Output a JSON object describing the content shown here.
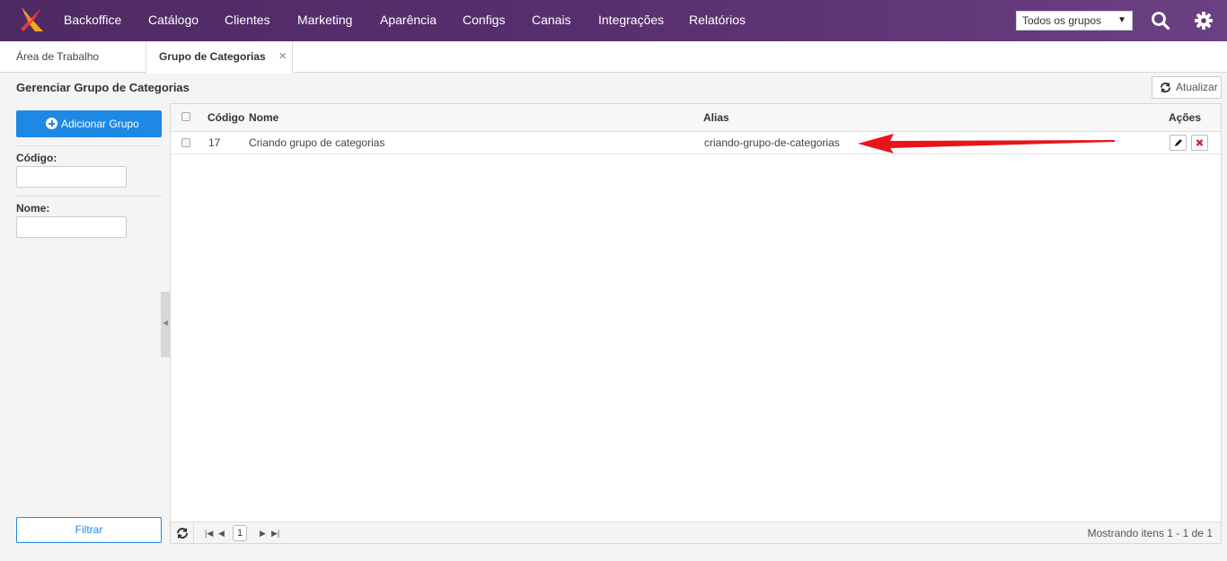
{
  "nav": {
    "items": [
      "Backoffice",
      "Catálogo",
      "Clientes",
      "Marketing",
      "Aparência",
      "Configs",
      "Canais",
      "Integrações",
      "Relatórios"
    ],
    "group_select": "Todos os grupos",
    "logo_icon": "x-logo-icon",
    "search_icon": "search-icon",
    "settings_icon": "gear-icon"
  },
  "tabs": [
    {
      "label": "Área de Trabalho",
      "active": false
    },
    {
      "label": "Grupo de Categorias",
      "active": true,
      "close": "×"
    }
  ],
  "page": {
    "title": "Gerenciar Grupo de Categorias",
    "refresh_label": "Atualizar"
  },
  "filters": {
    "add_label": "Adicionar Grupo",
    "code_label": "Código:",
    "code_value": "",
    "name_label": "Nome:",
    "name_value": "",
    "filter_label": "Filtrar"
  },
  "grid": {
    "columns": [
      "Código",
      "Nome",
      "Alias",
      "Ações"
    ],
    "rows": [
      {
        "code": "17",
        "name": "Criando grupo de categorias",
        "alias": "criando-grupo-de-categorias"
      }
    ],
    "pager": {
      "page": "1",
      "info": "Mostrando itens 1 - 1 de 1"
    }
  },
  "colors": {
    "nav_bg": "#5a3070",
    "primary": "#1e88e5",
    "annotation_arrow": "#e8141b"
  }
}
